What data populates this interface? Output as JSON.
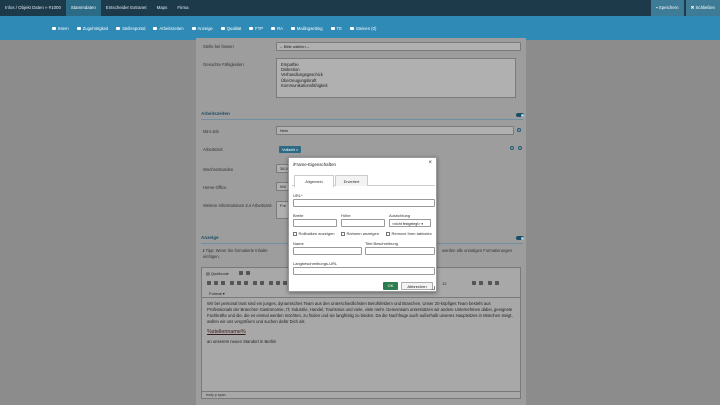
{
  "topbar": {
    "tabs": [
      "Infos / Objekt Daten » #1000",
      "Stammdaten",
      "Entscheider Extranet",
      "Maps",
      "Firma"
    ],
    "selected": 1,
    "save_label": "Speichern",
    "close_label": "Schließen"
  },
  "subbar": {
    "items": [
      "Intern",
      "Zugehörigkeit",
      "Stellenportal",
      "Arbeitszeiten",
      "Anzeige",
      "Qualität",
      "FTP",
      "RA",
      "Mailingsetting",
      "TE",
      "Steinen (0)"
    ]
  },
  "form": {
    "stelle_label": "Stelle bei fassen",
    "stelle_value": "-- Bitte wählen --",
    "faehigkeiten_label": "Gesuchte Fähigkeiten",
    "faehigkeiten": [
      "Empathie",
      "Diskretion",
      "Verhandlungsgeschick",
      "Überzeugungskraft",
      "Kommunikationsfähigkeit"
    ],
    "arbeitszeiten_section": "Arbeitszeiten",
    "minijob_label": "Mini-Job",
    "minijob_value": "Nein",
    "arbeitszeit_label": "Arbeitszeit",
    "arbeitszeit_tag": "Vollzeit",
    "wochenstunden_label": "Wochenstunden",
    "wochenstunden_value": "38,5",
    "homeoffice_label": "Home-Office",
    "homeoffice_value": "Wö",
    "weitere_label": "Weitere Informationen zur Arbeitszeit",
    "weitere_value": "Fre",
    "anzeige_section": "Anzeige",
    "anzeige_hint": "Tipp: Wenn Sie formatierte Inhalte",
    "anzeige_hint2": "einfügen.",
    "anzeige_side": "werden alle unnötigen Formatierungen"
  },
  "editor": {
    "quellcode": "Quellcode",
    "format": "Format",
    "fontsize": "12",
    "para1": "Wir bei personal trust sind ein junges, dynamisches Team aus den unterschiedlichsten Berufsfeldern und Branchen. Unser 20-köpfiges Team besteht aus Professionals der Branchen Gastronomie, IT, Industrie, Handel, Tourismus und viele, viele mehr. Gemeinsam unterstützen wir andere Unternehmen dabei, geeignete Fachkräfte und die, die es einmal werden möchten, zu finden und sie langfristig zu binden. Da die Nachfrage auch außerhalb unseres Hauptsitzes in München steigt, wollen wir uns vergrößern und suchen dafür Dich als",
    "placeholder": "%stellenname%",
    "para2": "an unserem neuen Standort in Berlin!",
    "footer": "body p span"
  },
  "modal": {
    "title": "iFrame-Eigenschaften",
    "tab_general": "Allgemein",
    "tab_advanced": "Erweitert",
    "url_label": "URL*",
    "breite_label": "Breite",
    "hoehe_label": "Höhe",
    "ausrichtung_label": "Ausrichtung",
    "ausrichtung_value": "<nicht festgelegt>",
    "cb_rollbalken": "Rollbalken anzeigen",
    "cb_rahmen": "Rahmen anzeigen",
    "cb_tabindex": "Remove from tabindex",
    "name_label": "Name",
    "titel_label": "Titel Beschreibung",
    "langbeschreibung_label": "Langbeschreibungs-URL",
    "ok_label": "OK",
    "cancel_label": "Abbrechen"
  },
  "colors": {
    "topbar": "#1d3a4b",
    "subbar": "#2f8ab6",
    "ok_button": "#2e7d4f"
  }
}
